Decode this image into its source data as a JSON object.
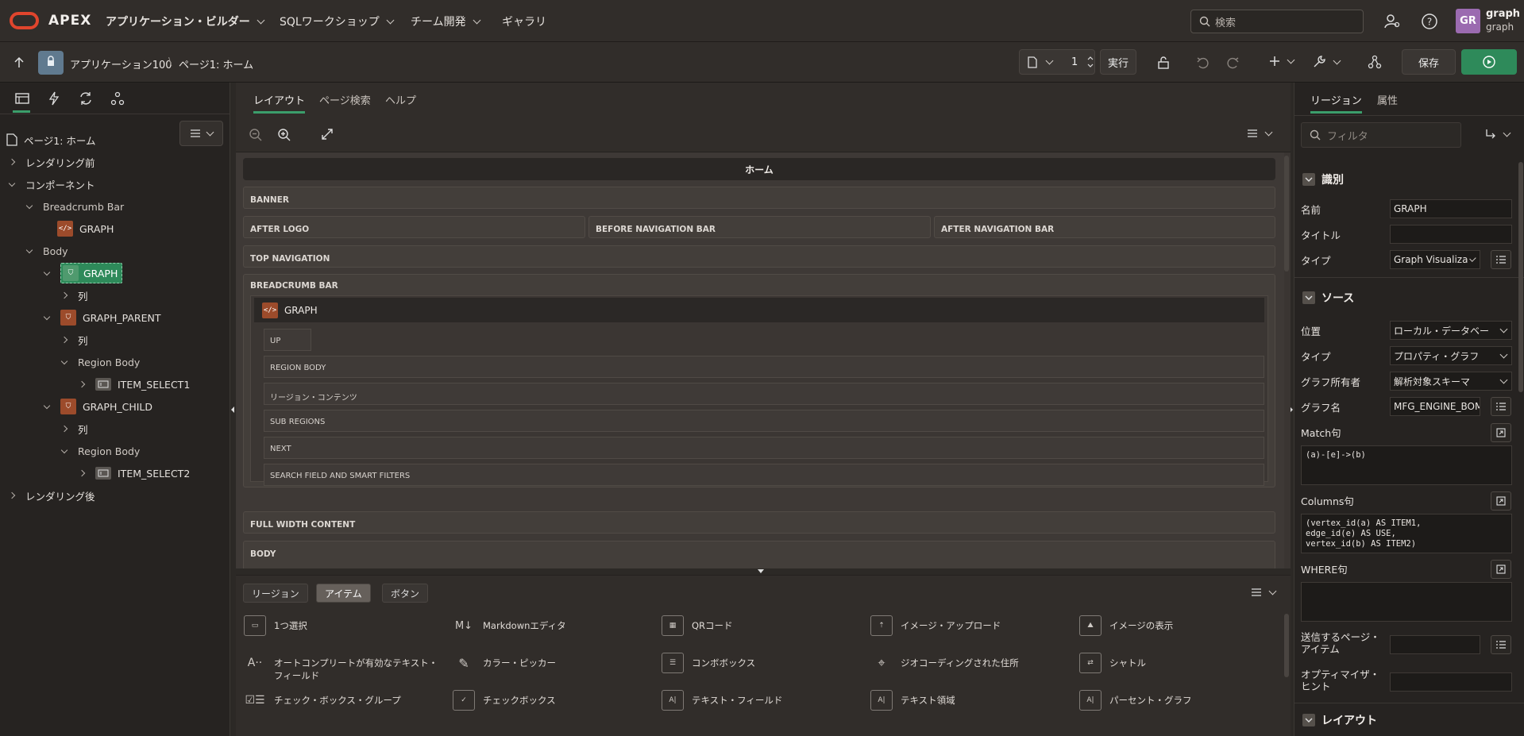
{
  "header": {
    "brand": "APEX",
    "menus": [
      {
        "label": "アプリケーション・ビルダー"
      },
      {
        "label": "SQLワークショップ"
      },
      {
        "label": "チーム開発"
      },
      {
        "label": "ギャラリ"
      }
    ],
    "search_placeholder": "検索",
    "user_initials": "GR",
    "user_name": "graph",
    "user_workspace": "graph"
  },
  "toolbar": {
    "app_name": "アプリケーション100",
    "separator": "\\",
    "page_name": "ページ1: ホーム",
    "page_number": "1",
    "run_label": "実行",
    "save_label": "保存"
  },
  "tree": {
    "root": "ページ1: ホーム",
    "before_render": "レンダリング前",
    "components": "コンポーネント",
    "breadcrumb_bar": "Breadcrumb Bar",
    "graph_breadcrumb": "GRAPH",
    "body": "Body",
    "graph": "GRAPH",
    "columns1": "列",
    "graph_parent": "GRAPH_PARENT",
    "columns2": "列",
    "region_body1": "Region Body",
    "item_select1": "ITEM_SELECT1",
    "graph_child": "GRAPH_CHILD",
    "columns3": "列",
    "region_body2": "Region Body",
    "item_select2": "ITEM_SELECT2",
    "after_render": "レンダリング後"
  },
  "center": {
    "tabs": [
      "レイアウト",
      "ページ検索",
      "ヘルプ"
    ],
    "page_title": "ホーム",
    "banner": "BANNER",
    "after_logo": "AFTER LOGO",
    "before_nav": "BEFORE NAVIGATION BAR",
    "after_nav": "AFTER NAVIGATION BAR",
    "top_nav": "TOP NAVIGATION",
    "breadcrumb_bar": "BREADCRUMB BAR",
    "graph_region": "GRAPH",
    "up": "UP",
    "region_body": "REGION BODY",
    "region_contents": "リージョン・コンテンツ",
    "sub_regions": "SUB REGIONS",
    "next": "NEXT",
    "search_field": "SEARCH FIELD AND SMART FILTERS",
    "full_width": "FULL WIDTH CONTENT",
    "body": "BODY"
  },
  "gallery": {
    "tabs": [
      "リージョン",
      "アイテム",
      "ボタン"
    ],
    "items": [
      {
        "label": "1つ選択",
        "icon": "select-list-icon"
      },
      {
        "label": "Markdownエディタ",
        "icon": "markdown-icon"
      },
      {
        "label": "QRコード",
        "icon": "qr-code-icon"
      },
      {
        "label": "イメージ・アップロード",
        "icon": "image-upload-icon"
      },
      {
        "label": "イメージの表示",
        "icon": "image-display-icon"
      },
      {
        "label": "オートコンプリートが有効なテキスト・フィールド",
        "icon": "autocomplete-icon"
      },
      {
        "label": "カラー・ピッカー",
        "icon": "color-picker-icon"
      },
      {
        "label": "コンボボックス",
        "icon": "combobox-icon"
      },
      {
        "label": "ジオコーディングされた住所",
        "icon": "geocode-icon"
      },
      {
        "label": "シャトル",
        "icon": "shuttle-icon"
      },
      {
        "label": "チェック・ボックス・グループ",
        "icon": "checkbox-group-icon"
      },
      {
        "label": "チェックボックス",
        "icon": "checkbox-icon"
      },
      {
        "label": "テキスト・フィールド",
        "icon": "text-field-icon"
      },
      {
        "label": "テキスト領域",
        "icon": "textarea-icon"
      },
      {
        "label": "パーセント・グラフ",
        "icon": "percent-graph-icon"
      }
    ]
  },
  "props": {
    "tabs": [
      "リージョン",
      "属性"
    ],
    "filter_placeholder": "フィルタ",
    "section_identification": "識別",
    "name_label": "名前",
    "name_value": "GRAPH",
    "title_label": "タイトル",
    "title_value": "",
    "type_label": "タイプ",
    "type_value": "Graph Visualiza",
    "section_source": "ソース",
    "location_label": "位置",
    "location_value": "ローカル・データベー",
    "source_type_label": "タイプ",
    "source_type_value": "プロパティ・グラフ",
    "graph_owner_label": "グラフ所有者",
    "graph_owner_value": "解析対象スキーマ",
    "graph_name_label": "グラフ名",
    "graph_name_value": "MFG_ENGINE_BOM",
    "match_label": "Match句",
    "match_value": "(a)-[e]->(b)",
    "columns_label": "Columns句",
    "columns_value": "(vertex_id(a) AS ITEM1,\nedge_id(e) AS USE,\nvertex_id(b) AS ITEM2)",
    "where_label": "WHERE句",
    "where_value": "",
    "submit_label": "送信するページ・アイテム",
    "optimizer_label": "オプティマイザ・ヒント",
    "section_layout": "レイアウト"
  },
  "colors": {
    "accent_green": "#3b9e6b",
    "region_orange": "#9c4b2b",
    "oracle_red": "#e0452d",
    "avatar_purple": "#9b6bb0"
  }
}
